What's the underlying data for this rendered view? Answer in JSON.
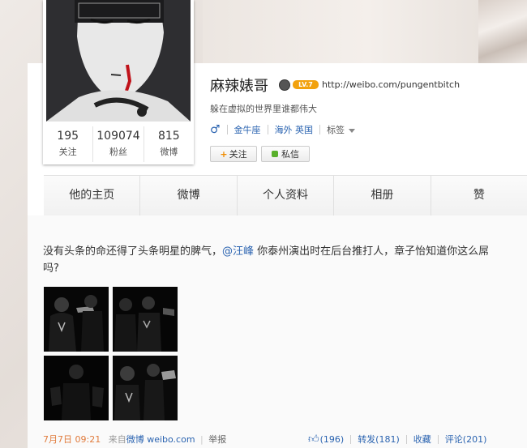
{
  "profile": {
    "name": "麻辣婊哥",
    "level": "LV.7",
    "url": "http://weibo.com/pungentbitch",
    "bio": "躲在虚拟的世界里谁都伟大",
    "gender_icon": "♂",
    "zodiac": "金牛座",
    "location": "海外 英国",
    "tags_label": "标签"
  },
  "stats": [
    {
      "value": "195",
      "label": "关注"
    },
    {
      "value": "109074",
      "label": "粉丝"
    },
    {
      "value": "815",
      "label": "微博"
    }
  ],
  "buttons": {
    "follow": "关注",
    "message": "私信"
  },
  "tabs": [
    {
      "label": "他的主页"
    },
    {
      "label": "微博"
    },
    {
      "label": "个人资料"
    },
    {
      "label": "相册"
    },
    {
      "label": "赞"
    }
  ],
  "post": {
    "text_before": "没有头条的命还得了头条明星的脾气，",
    "mention": "@汪峰",
    "text_after": " 你泰州演出时在后台推打人，章子怡知道你这么屌吗?",
    "date": "7月7日 09:21",
    "source_prefix": "来自",
    "source": "微博 weibo.com",
    "report": "举报",
    "likes": "(196)",
    "repost": "转发(181)",
    "favorite": "收藏",
    "comment": "评论(201)"
  },
  "colors": {
    "link": "#2a63b0",
    "level_badge": "#f2a20e"
  }
}
